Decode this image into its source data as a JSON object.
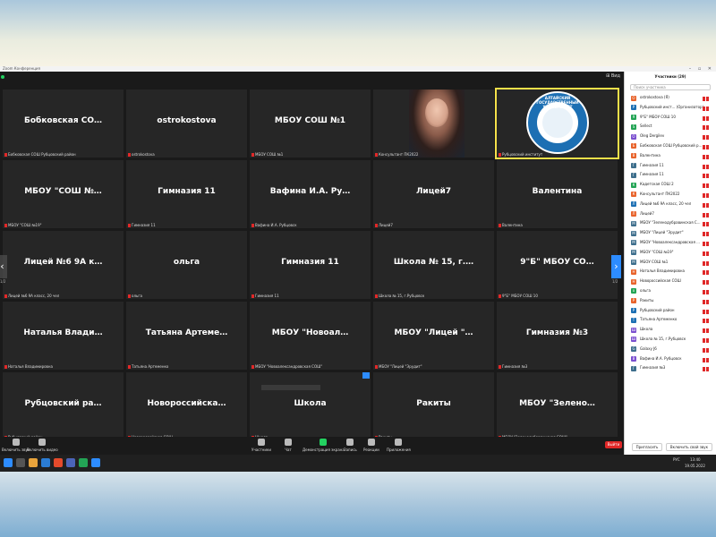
{
  "app": {
    "title": "Zoom Конференция",
    "view_label": "⊞ Вид",
    "window_controls": "– ▫ ✕"
  },
  "tiles": [
    {
      "name": "Бобковская СО…",
      "label": "Бобковская СОШ Рубцовский район"
    },
    {
      "name": "ostrokostova",
      "label": "ostrokostova"
    },
    {
      "name": "МБОУ СОШ №1",
      "label": "МБОУ СОШ №1"
    },
    {
      "name": "",
      "label": "Консультант ПК2022",
      "type": "photo"
    },
    {
      "name": "",
      "label": "Рубцовский институт",
      "type": "logo",
      "logo_text": "АЛТАЙСКИЙ ГОСУДАРСТВЕННЫЙ УНИВЕРСИТЕТ",
      "logo_sub": "Рубцовский институт"
    },
    {
      "name": "МБОУ \"СОШ №…",
      "label": "МБОУ \"СОШ №19\""
    },
    {
      "name": "Гимназия 11",
      "label": "Гимназия 11"
    },
    {
      "name": "Вафина И.А. Ру…",
      "label": "Вафина И.А. Рубцовск"
    },
    {
      "name": "Лицей7",
      "label": "Лицей7"
    },
    {
      "name": "Валентина",
      "label": "Валентина"
    },
    {
      "name": "Лицей №6 9А к…",
      "label": "Лицей №6 9А класс, 20 чел"
    },
    {
      "name": "ольга",
      "label": "ольга"
    },
    {
      "name": "Гимназия 11",
      "label": "Гимназия 11"
    },
    {
      "name": "Школа № 15, г.…",
      "label": "Школа № 15, г.Рубцовск"
    },
    {
      "name": "9\"Б\" МБОУ СО…",
      "label": "9\"Б\" МБОУ СОШ 10"
    },
    {
      "name": "Наталья Влади…",
      "label": "Наталья Владимировна"
    },
    {
      "name": "Татьяна Артеме…",
      "label": "Татьяна Артеменко"
    },
    {
      "name": "МБОУ \"Новоал…",
      "label": "МБОУ \"Новоалександровская СОШ\""
    },
    {
      "name": "МБОУ \"Лицей \"…",
      "label": "МБОУ \"Лицей \"Эрудит\""
    },
    {
      "name": "Гимназия №3",
      "label": "Гимназия №3"
    },
    {
      "name": "Рубцовский ра…",
      "label": "Рубцовский район"
    },
    {
      "name": "Новороссийска…",
      "label": "Новороссийская СОШ"
    },
    {
      "name": "Школа",
      "label": "Школа"
    },
    {
      "name": "Ракиты",
      "label": "Ракиты"
    },
    {
      "name": "МБОУ \"Зелено…",
      "label": "МБОУ \"Зеленодубравинская СОШ\""
    }
  ],
  "nav": {
    "left": "‹",
    "right": "›",
    "left_page": "1/2",
    "right_page": "1/2"
  },
  "toolbar": {
    "mute": "Включить звук",
    "video": "Включить видео",
    "participants": "Участники",
    "chat": "Чат",
    "share": "Демонстрация экрана",
    "record": "Запись",
    "reactions": "Реакции",
    "apps": "Приложения",
    "leave": "Выйти"
  },
  "panel": {
    "title": "Участники (29)",
    "search_placeholder": "Поиск участника",
    "invite": "Пригласить",
    "unmute_me": "Включить свой звук",
    "participants": [
      {
        "initial": "O",
        "name": "ostrokostova (Я)",
        "color": "#e8632b"
      },
      {
        "initial": "Р",
        "name": "Рубцовский инст... (Организатор)",
        "color": "#1c6fb3"
      },
      {
        "initial": "9",
        "name": "9\"Б\" МБОУ СОШ 10",
        "color": "#23a455"
      },
      {
        "initial": "S",
        "name": "Sellect",
        "color": "#23a455"
      },
      {
        "initial": "O",
        "name": "Oleg Dergilev",
        "color": "#7a4fcf"
      },
      {
        "initial": "Б",
        "name": "Бобковская СОШ Рубцовский р...",
        "color": "#e8632b"
      },
      {
        "initial": "В",
        "name": "Валентина",
        "color": "#e8632b"
      },
      {
        "initial": "Г",
        "name": "Гимназия 11",
        "color": "#3d6e8c"
      },
      {
        "initial": "Г",
        "name": "Гимназия 11",
        "color": "#3d6e8c"
      },
      {
        "initial": "К",
        "name": "Кадетская СОШ 2",
        "color": "#23a455"
      },
      {
        "initial": "К",
        "name": "Консультант ПК2022",
        "color": "#e8632b"
      },
      {
        "initial": "Л",
        "name": "Лицей №6 9А класс, 20 чел",
        "color": "#1c6fb3"
      },
      {
        "initial": "Л",
        "name": "Лицей7",
        "color": "#e8632b"
      },
      {
        "initial": "М",
        "name": "МБОУ \"Зеленодубравинская С...",
        "color": "#3d6e8c"
      },
      {
        "initial": "М",
        "name": "МБОУ \"Лицей \"Эрудит\"",
        "color": "#3d6e8c"
      },
      {
        "initial": "М",
        "name": "МБОУ \"Новоалександровская ...",
        "color": "#3d6e8c"
      },
      {
        "initial": "М",
        "name": "МБОУ \"СОШ №19\"",
        "color": "#3d6e8c"
      },
      {
        "initial": "М",
        "name": "МБОУ СОШ №1",
        "color": "#3d6e8c"
      },
      {
        "initial": "Н",
        "name": "Наталья Владимировна",
        "color": "#e8632b"
      },
      {
        "initial": "Н",
        "name": "Новороссийская СОШ",
        "color": "#e8632b"
      },
      {
        "initial": "о",
        "name": "ольга",
        "color": "#23a455"
      },
      {
        "initial": "Р",
        "name": "Ракиты",
        "color": "#e8632b"
      },
      {
        "initial": "Р",
        "name": "Рубцовский район",
        "color": "#1c6fb3"
      },
      {
        "initial": "Т",
        "name": "Татьяна Артеменко",
        "color": "#1c6fb3"
      },
      {
        "initial": "Ш",
        "name": "Школа",
        "color": "#7a4fcf"
      },
      {
        "initial": "Ш",
        "name": "Школа № 15, г.Рубцовск",
        "color": "#7a4fcf"
      },
      {
        "initial": "G",
        "name": "Galaxy J6",
        "color": "#3d6e8c"
      },
      {
        "initial": "В",
        "name": "Вафина И.А. Рубцовск",
        "color": "#7a4fcf"
      },
      {
        "initial": "Г",
        "name": "Гимназия №3",
        "color": "#3d6e8c"
      }
    ]
  },
  "taskbar": {
    "time": "13:40",
    "date": "19.05.2022",
    "lang": "РУС"
  }
}
